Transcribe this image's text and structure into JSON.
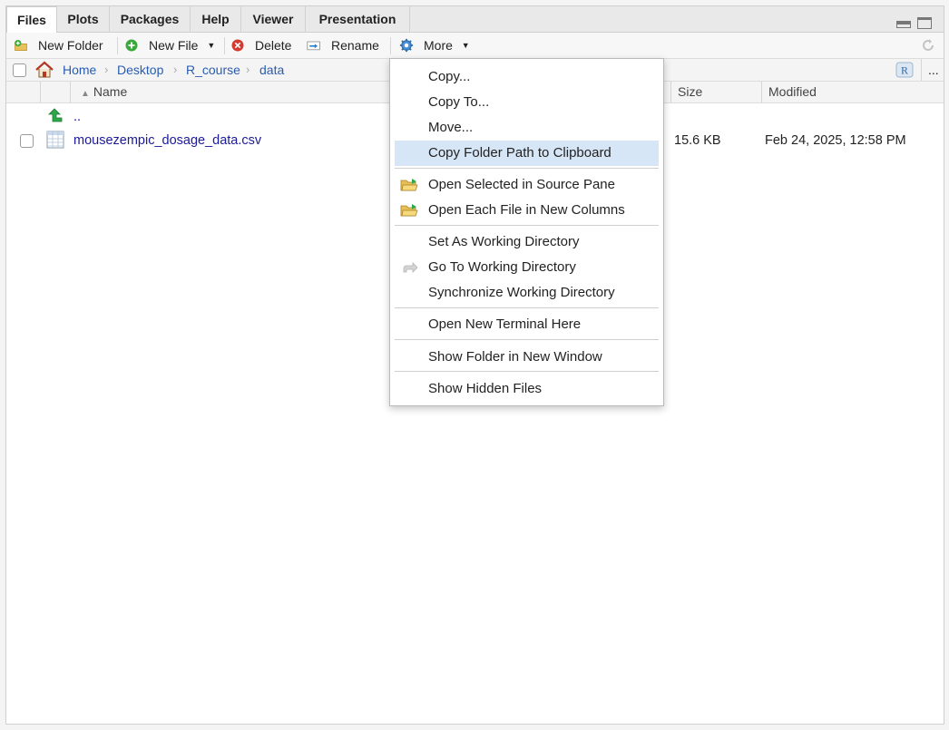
{
  "tabs": [
    {
      "label": "Files",
      "active": true
    },
    {
      "label": "Plots"
    },
    {
      "label": "Packages"
    },
    {
      "label": "Help"
    },
    {
      "label": "Viewer"
    },
    {
      "label": "Presentation"
    }
  ],
  "toolbar": {
    "new_folder": "New Folder",
    "new_file": "New File",
    "delete": "Delete",
    "rename": "Rename",
    "more": "More",
    "overflow": "..."
  },
  "breadcrumb": {
    "items": [
      "Home",
      "Desktop",
      "R_course",
      "data"
    ]
  },
  "columns": {
    "name": "Name",
    "size": "Size",
    "modified": "Modified"
  },
  "files": [
    {
      "name": "..",
      "type": "parent",
      "size": "",
      "modified": ""
    },
    {
      "name": "mousezempic_dosage_data.csv",
      "type": "csv",
      "size": "15.6 KB",
      "modified": "Feb 24, 2025, 12:58 PM"
    }
  ],
  "menu": {
    "items": [
      {
        "label": "Copy...",
        "icon": ""
      },
      {
        "label": "Copy To...",
        "icon": ""
      },
      {
        "label": "Move...",
        "icon": ""
      },
      {
        "label": "Copy Folder Path to Clipboard",
        "icon": "",
        "highlighted": true
      },
      {
        "label": "Open Selected in Source Pane",
        "icon": "open-folder-icon"
      },
      {
        "label": "Open Each File in New Columns",
        "icon": "open-folder-icon"
      },
      {
        "label": "Set As Working Directory",
        "icon": ""
      },
      {
        "label": "Go To Working Directory",
        "icon": "goto-arrow-icon"
      },
      {
        "label": "Synchronize Working Directory",
        "icon": ""
      },
      {
        "label": "Open New Terminal Here",
        "icon": ""
      },
      {
        "label": "Show Folder in New Window",
        "icon": ""
      },
      {
        "label": "Show Hidden Files",
        "icon": ""
      }
    ]
  },
  "colors": {
    "link": "#1a1a9c",
    "crumb_link": "#2a5db0",
    "menu_highlight": "#d6e6f6"
  }
}
